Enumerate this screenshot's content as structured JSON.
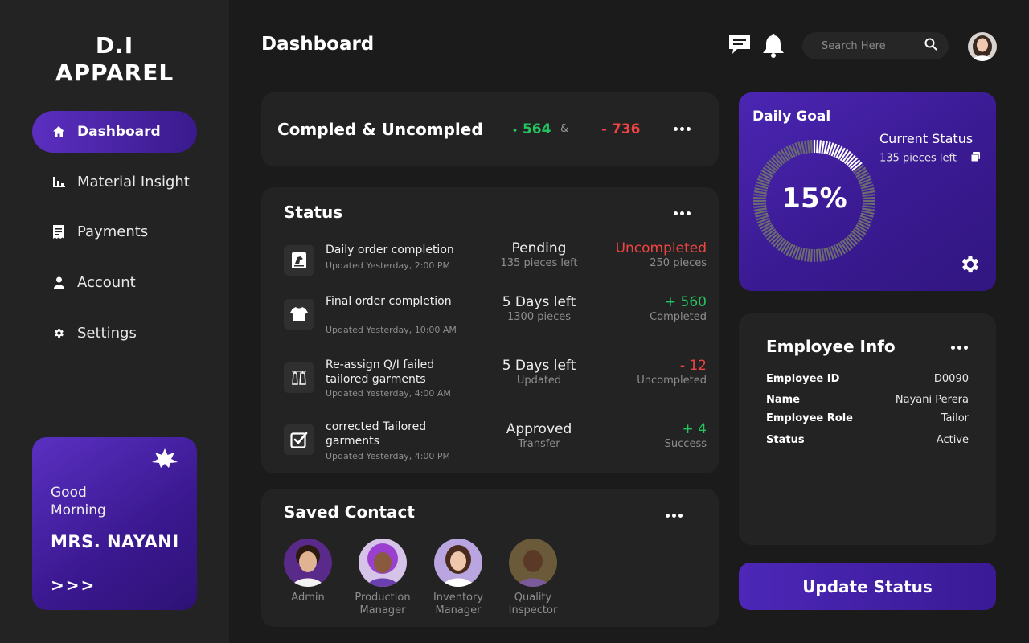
{
  "brand": {
    "line1": "D.I",
    "line2": "APPAREL"
  },
  "sidebar": {
    "items": [
      {
        "label": "Dashboard",
        "icon": "home-icon"
      },
      {
        "label": "Material Insight",
        "icon": "bar-chart-icon"
      },
      {
        "label": "Payments",
        "icon": "receipt-icon"
      },
      {
        "label": "Account",
        "icon": "user-icon"
      },
      {
        "label": "Settings",
        "icon": "gear-icon"
      }
    ]
  },
  "greeting": {
    "line": "Good Morning",
    "name": "MRS. NAYANI",
    "arrows": ">>>"
  },
  "header": {
    "title": "Dashboard",
    "search_placeholder": "Search Here"
  },
  "summary": {
    "title": "Compled & Uncompled",
    "completed": "564",
    "separator": "&",
    "uncompleted": "736",
    "completed_prefix": "•",
    "uncompleted_prefix": "-"
  },
  "status": {
    "title": "Status",
    "rows": [
      {
        "name": "Daily order completion",
        "updated": "Updated Yesterday, 2:00 PM",
        "mid_a": "Pending",
        "mid_b": "135 pieces left",
        "right_a": "Uncompleted",
        "right_b": "250 pieces",
        "tone": "red"
      },
      {
        "name": "Final order completion",
        "updated": "Updated Yesterday, 10:00 AM",
        "mid_a": "5 Days left",
        "mid_b": "1300 pieces",
        "right_a": "+ 560",
        "right_b": "Completed",
        "tone": "green"
      },
      {
        "name": "Re-assign Q/I failed tailored garments",
        "updated": "Updated Yesterday, 4:00 AM",
        "mid_a": "5 Days left",
        "mid_b": "Updated",
        "right_a": "- 12",
        "right_b": "Uncompleted",
        "tone": "red"
      },
      {
        "name": "corrected Tailored garments",
        "updated": "Updated Yesterday, 4:00 PM",
        "mid_a": "Approved",
        "mid_b": "Transfer",
        "right_a": "+ 4",
        "right_b": "Success",
        "tone": "green"
      }
    ]
  },
  "contacts": {
    "title": "Saved Contact",
    "people": [
      {
        "label": "Admin"
      },
      {
        "label": "Production Manager"
      },
      {
        "label": "Inventory Manager"
      },
      {
        "label": "Quality Inspector"
      }
    ]
  },
  "goal": {
    "title": "Daily Goal",
    "status_label": "Current Status",
    "status_detail": "135 pieces left",
    "percent_text": "15%",
    "progress": 0.15
  },
  "employee": {
    "title": "Employee Info",
    "fields": [
      {
        "key": "Employee ID",
        "value": "D0090"
      },
      {
        "key": "Name",
        "value": "Nayani Perera"
      },
      {
        "key": "Employee Role",
        "value": "Tailor"
      },
      {
        "key": "Status",
        "value": "Active"
      }
    ]
  },
  "update_button": "Update Status",
  "colors": {
    "accent": "#4c27b8",
    "positive": "#22c55e",
    "negative": "#ef4444",
    "background": "#1b1b1b",
    "card": "#232323"
  }
}
